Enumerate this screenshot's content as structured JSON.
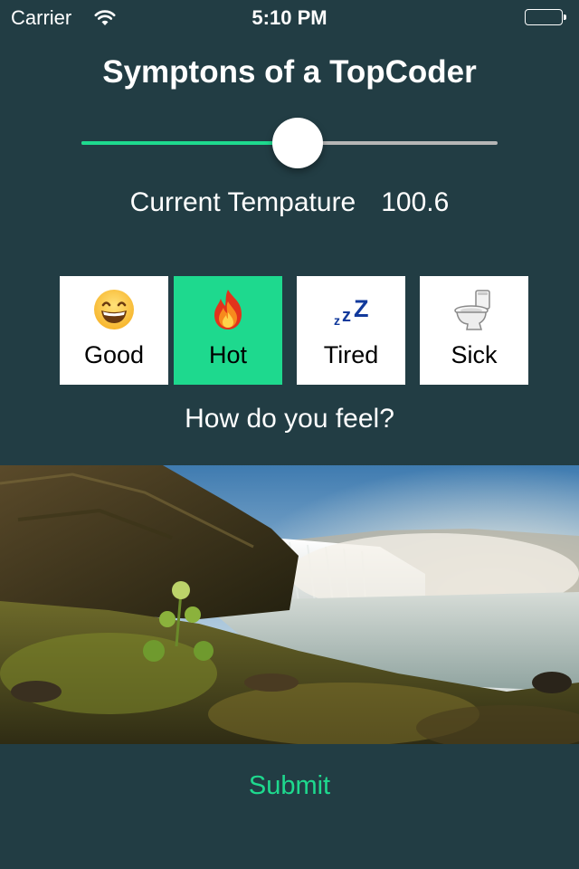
{
  "status_bar": {
    "carrier": "Carrier",
    "time": "5:10 PM",
    "icons": [
      "wifi-icon",
      "battery-icon"
    ]
  },
  "title": "Symptons of a TopCoder",
  "temperature": {
    "label": "Current Tempature",
    "value": "100.6",
    "slider_fraction": 0.52
  },
  "moods": [
    {
      "label": "Good",
      "icon": "grinning-face-icon",
      "selected": false
    },
    {
      "label": "Hot",
      "icon": "fire-icon",
      "selected": true
    },
    {
      "label": "Tired",
      "icon": "zzz-icon",
      "selected": false
    },
    {
      "label": "Sick",
      "icon": "toilet-icon",
      "selected": false
    }
  ],
  "prompt": "How do you feel?",
  "image": {
    "subject": "waterfall-landscape"
  },
  "submit_label": "Submit",
  "colors": {
    "background": "#223d44",
    "accent": "#1ed98e",
    "text": "#ffffff",
    "track": "#b6b6b6"
  }
}
